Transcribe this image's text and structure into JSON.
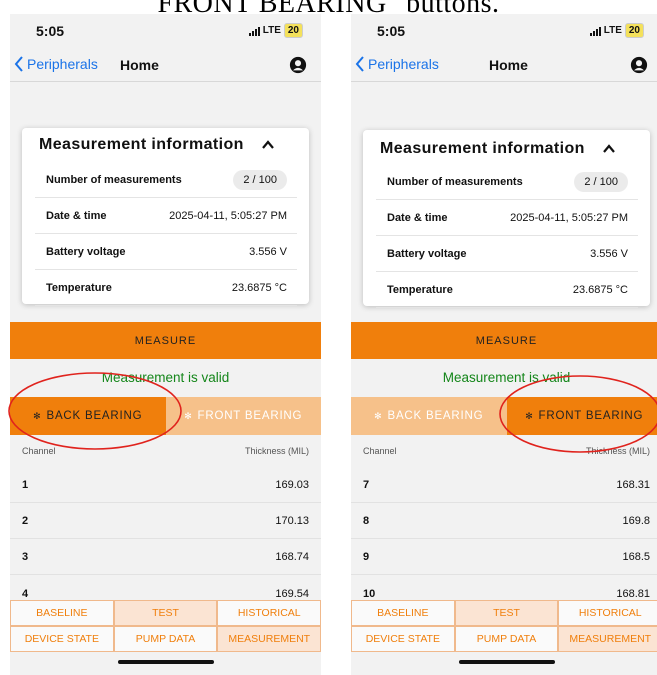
{
  "caption": "FRONT BEARING\" buttons.",
  "status": {
    "time": "5:05",
    "network": "LTE",
    "battery": "20"
  },
  "navbar": {
    "back_label": "Peripherals",
    "title": "Home"
  },
  "card": {
    "title": "Measurement information",
    "rows": [
      {
        "label": "Number of measurements",
        "value": "2 / 100"
      },
      {
        "label": "Date & time",
        "value": "2025-04-11, 5:05:27 PM"
      },
      {
        "label": "Battery voltage",
        "value": "3.556 V"
      },
      {
        "label": "Temperature",
        "value": "23.6875 °C"
      }
    ]
  },
  "measure_label": "MEASURE",
  "valid_message": "Measurement is valid",
  "tabs": {
    "back": "BACK BEARING",
    "front": "FRONT BEARING"
  },
  "table": {
    "col_channel": "Channel",
    "col_thickness": "Thickness (MIL)"
  },
  "left_rows": [
    {
      "channel": "1",
      "value": "169.03"
    },
    {
      "channel": "2",
      "value": "170.13"
    },
    {
      "channel": "3",
      "value": "168.74"
    },
    {
      "channel": "4",
      "value": "169.54"
    }
  ],
  "right_rows": [
    {
      "channel": "7",
      "value": "168.31"
    },
    {
      "channel": "8",
      "value": "169.8"
    },
    {
      "channel": "9",
      "value": "168.5"
    },
    {
      "channel": "10",
      "value": "168.81"
    }
  ],
  "bottom_nav": [
    "BASELINE",
    "TEST",
    "HISTORICAL",
    "DEVICE STATE",
    "PUMP DATA",
    "MEASUREMENT"
  ],
  "selected_bottom_nav": [
    "TEST",
    "MEASUREMENT"
  ],
  "left_active_tab": "BACK BEARING",
  "right_active_tab": "FRONT BEARING",
  "colors": {
    "accent": "#f07f0c",
    "accent_light": "#f6c18a",
    "valid": "#14861a",
    "link": "#1a73e8",
    "annotation": "#e0231d"
  }
}
